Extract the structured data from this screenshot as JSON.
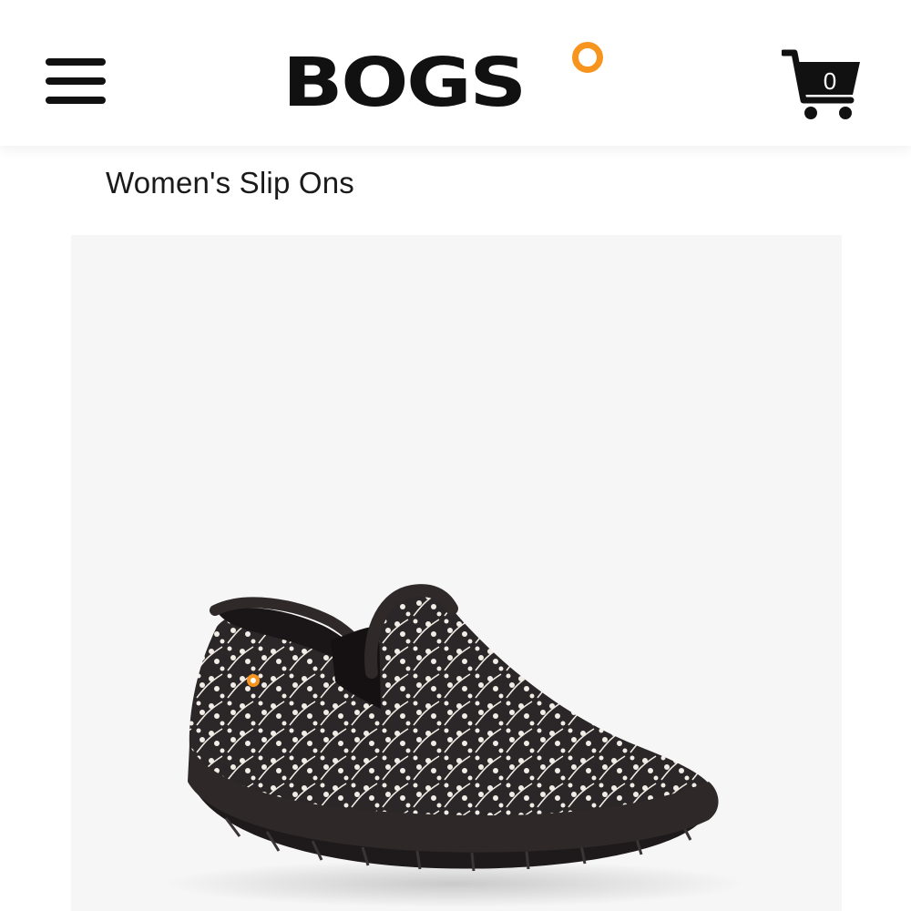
{
  "header": {
    "menu_icon": "hamburger-menu-icon",
    "logo_text": "BOGS",
    "logo_accent_color": "#f7941d",
    "cart_icon": "shopping-cart-icon",
    "cart_count": "0"
  },
  "page": {
    "title": "Women's Slip Ons"
  },
  "product": {
    "image_subject": "patterned slip-on shoe",
    "shoe_color": "#2b2627",
    "pattern_color": "#f2ece6"
  }
}
